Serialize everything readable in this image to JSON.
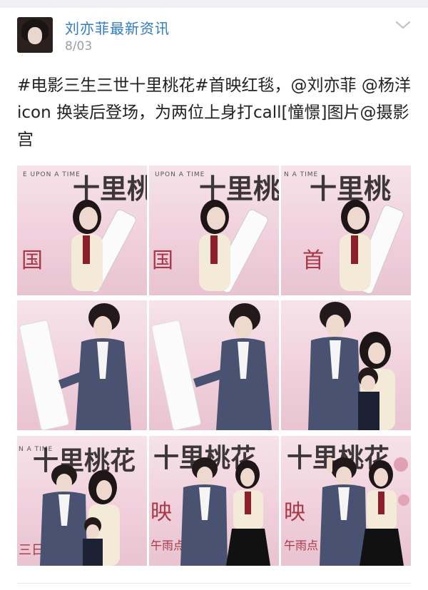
{
  "post": {
    "author_name": "刘亦菲最新资讯",
    "date": "8/03",
    "text": "#电影三生三世十里桃花#首映红毯，@刘亦菲 @杨洋icon 换装后登场，为两位上身打call[憧憬]图片@摄影宫"
  },
  "icons": {
    "chevron": "chevron-down-icon"
  },
  "photos": [
    {
      "id": "photo-1",
      "caption": ""
    },
    {
      "id": "photo-2",
      "caption": ""
    },
    {
      "id": "photo-3",
      "caption": ""
    },
    {
      "id": "photo-4",
      "caption": ""
    },
    {
      "id": "photo-5",
      "caption": ""
    },
    {
      "id": "photo-6",
      "caption": ""
    },
    {
      "id": "photo-7",
      "caption": ""
    },
    {
      "id": "photo-8",
      "caption": ""
    },
    {
      "id": "photo-9",
      "caption": ""
    }
  ],
  "backdrop_text": {
    "upon": "UPON A TIME",
    "upon2": "E UPON A TIME",
    "n_time": "N A TIME",
    "title_a": "十里桃",
    "title_b": "十里桃花",
    "red_a": "国",
    "red_b": "首",
    "red_c": "映",
    "red_d": "三日",
    "red_e": "午雨点"
  },
  "colors": {
    "name": "#2f7bbf",
    "date": "#9aa0a6",
    "text": "#222222",
    "backdrop": "#f0d0dc"
  }
}
